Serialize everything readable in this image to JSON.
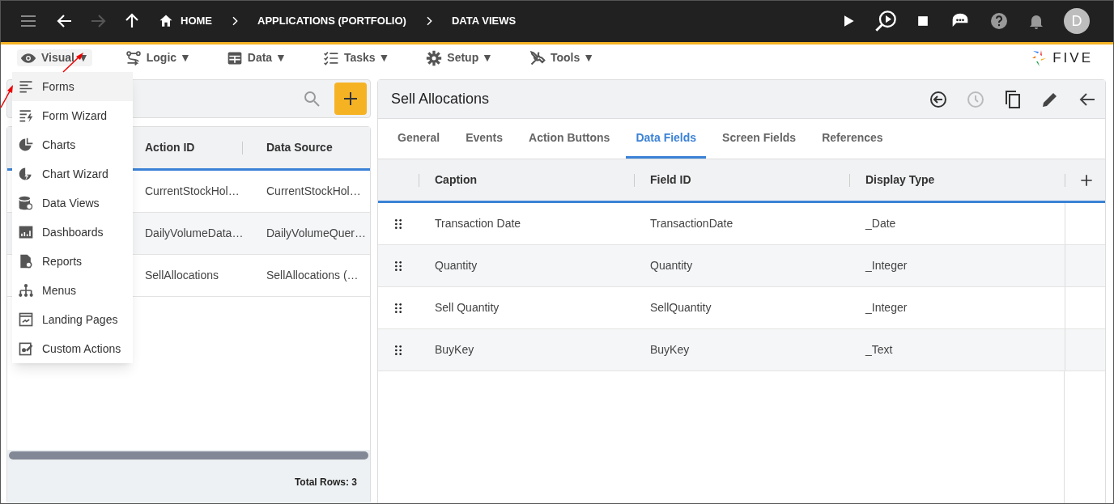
{
  "top_bar": {
    "breadcrumbs": [
      {
        "kind": "home",
        "label": "HOME"
      },
      {
        "kind": "crumb",
        "label": "APPLICATIONS (PORTFOLIO)"
      },
      {
        "kind": "crumb",
        "label": "DATA VIEWS"
      }
    ],
    "avatar": "D"
  },
  "menu_bar": {
    "items": [
      {
        "kind": "eye",
        "label": "Visual",
        "caret": "▼",
        "expanded": true
      },
      {
        "kind": "logic",
        "label": "Logic",
        "caret": "▼",
        "expanded": false
      },
      {
        "kind": "table",
        "label": "Data",
        "caret": "▼",
        "expanded": false
      },
      {
        "kind": "tasks",
        "label": "Tasks",
        "caret": "▼",
        "expanded": false
      },
      {
        "kind": "gear",
        "label": "Setup",
        "caret": "▼",
        "expanded": false
      },
      {
        "kind": "tools",
        "label": "Tools",
        "caret": "▼",
        "expanded": false
      }
    ],
    "logo": "FIVE"
  },
  "dropdown": [
    {
      "kind": "forms",
      "label": "Forms",
      "selected": true
    },
    {
      "kind": "wizard",
      "label": "Form Wizard",
      "selected": false
    },
    {
      "kind": "charts",
      "label": "Charts",
      "selected": false
    },
    {
      "kind": "chartwizard",
      "label": "Chart Wizard",
      "selected": false
    },
    {
      "kind": "db",
      "label": "Data Views",
      "selected": false
    },
    {
      "kind": "dash",
      "label": "Dashboards",
      "selected": false
    },
    {
      "kind": "report",
      "label": "Reports",
      "selected": false
    },
    {
      "kind": "menus",
      "label": "Menus",
      "selected": false
    },
    {
      "kind": "landing",
      "label": "Landing Pages",
      "selected": false
    },
    {
      "kind": "custom",
      "label": "Custom Actions",
      "selected": false
    }
  ],
  "list_panel": {
    "columns": [
      "Action ID",
      "Data Source"
    ],
    "rows": [
      [
        "CurrentStockHol…",
        "CurrentStockHol…"
      ],
      [
        "DailyVolumeData…",
        "DailyVolumeQuer…"
      ],
      [
        "SellAllocations",
        "SellAllocations (…"
      ]
    ],
    "total": "Total Rows: 3"
  },
  "detail": {
    "title": "Sell Allocations",
    "tabs": [
      {
        "label": "General",
        "selected": false
      },
      {
        "label": "Events",
        "selected": false
      },
      {
        "label": "Action Buttons",
        "selected": false
      },
      {
        "label": "Data Fields",
        "selected": true
      },
      {
        "label": "Screen Fields",
        "selected": false
      },
      {
        "label": "References",
        "selected": false
      }
    ],
    "columns": [
      "Caption",
      "Field ID",
      "Display Type"
    ],
    "rows": [
      [
        "Transaction Date",
        "TransactionDate",
        "_Date"
      ],
      [
        "Quantity",
        "Quantity",
        "_Integer"
      ],
      [
        "Sell Quantity",
        "SellQuantity",
        "_Integer"
      ],
      [
        "BuyKey",
        "BuyKey",
        "_Text"
      ]
    ]
  }
}
